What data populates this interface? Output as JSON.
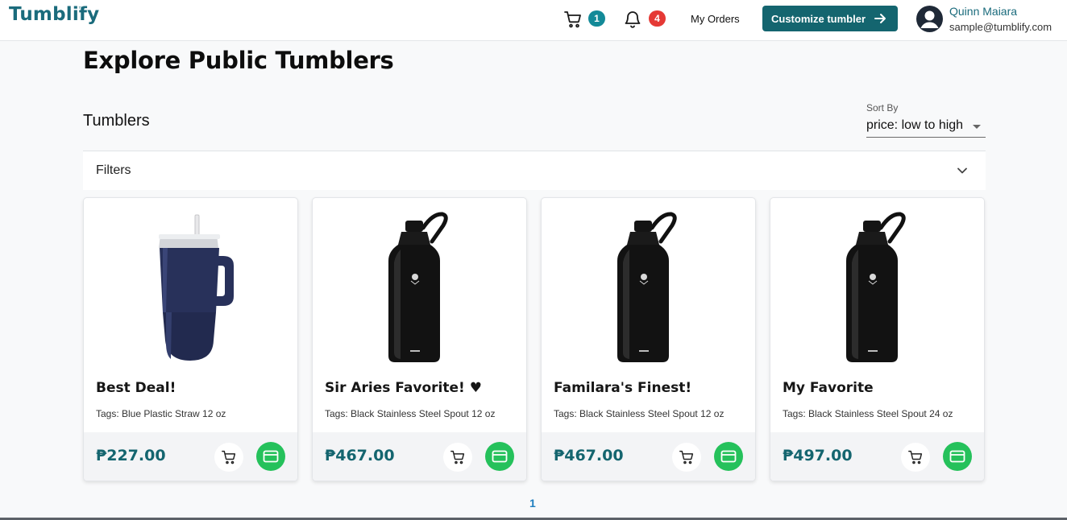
{
  "header": {
    "logo": "Tumblify",
    "logo_mark": "™",
    "cart_count": "1",
    "notification_count": "4",
    "my_orders": "My Orders",
    "cta": "Customize tumbler",
    "user": {
      "name": "Quinn Maiara",
      "email": "sample@tumblify.com"
    }
  },
  "page": {
    "title": "Explore Public Tumblers",
    "section": "Tumblers",
    "sort_label": "Sort By",
    "sort_value": "price: low to high",
    "filters": "Filters"
  },
  "products": [
    {
      "title": "Best Deal!",
      "tags": "Tags: Blue Plastic Straw 12 oz",
      "price": "₱227.00",
      "image": "navy-tumbler-with-handle"
    },
    {
      "title": "Sir Aries Favorite! ♥",
      "tags": "Tags: Black Stainless Steel Spout 12 oz",
      "price": "₱467.00",
      "image": "black-bottle-spout-lid"
    },
    {
      "title": "Familara's Finest!",
      "tags": "Tags: Black Stainless Steel Spout 12 oz",
      "price": "₱467.00",
      "image": "black-bottle-spout-lid"
    },
    {
      "title": "My Favorite",
      "tags": "Tags: Black Stainless Steel Spout 24 oz",
      "price": "₱497.00",
      "image": "black-bottle-spout-lid"
    }
  ],
  "pagination": {
    "current": "1"
  },
  "icons": {
    "cart": "cart-icon",
    "bell": "bell-icon",
    "arrow": "arrow-right-icon",
    "avatar": "user-avatar-icon",
    "chevron": "chevron-down-icon",
    "pay": "credit-card-icon"
  },
  "colors": {
    "brand": "#14656f",
    "cart_badge": "#138a98",
    "notif_badge": "#e53935",
    "pay_button": "#25c15b",
    "pagination": "#1f7fbf"
  }
}
